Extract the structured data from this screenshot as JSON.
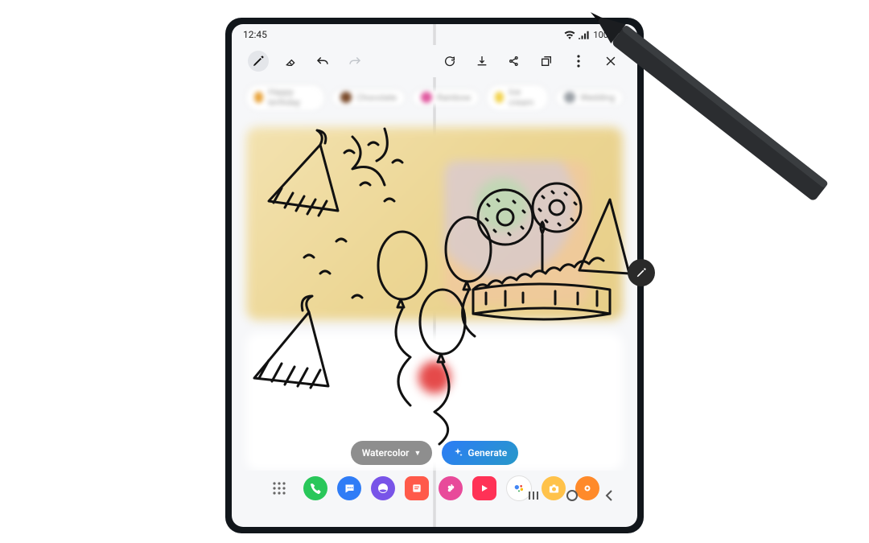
{
  "status_bar": {
    "time": "12:45",
    "battery": "100%",
    "wifi_icon": "wifi",
    "signal_icon": "signal-full"
  },
  "toolbar": {
    "left": [
      {
        "name": "pen-icon",
        "selected": true
      },
      {
        "name": "eraser-icon",
        "selected": false
      },
      {
        "name": "undo-icon",
        "selected": false
      },
      {
        "name": "redo-icon",
        "selected": false,
        "disabled": true
      }
    ],
    "right": [
      {
        "name": "refresh-icon"
      },
      {
        "name": "download-icon"
      },
      {
        "name": "share-icon"
      },
      {
        "name": "multiwindow-icon"
      },
      {
        "name": "more-icon"
      },
      {
        "name": "close-icon"
      }
    ]
  },
  "suggestion_chips": [
    {
      "label": "Happy birthday",
      "swatch": "#e8a23a"
    },
    {
      "label": "Chocolate",
      "swatch": "#7a4a2a"
    },
    {
      "label": "Rainbow",
      "swatch": "#e05aa0"
    },
    {
      "label": "Ice cream",
      "swatch": "#f2d24a"
    },
    {
      "label": "Wedding",
      "swatch": "#9aa0a6"
    }
  ],
  "style_picker": {
    "label": "Watercolor"
  },
  "generate_button": {
    "label": "Generate"
  },
  "floating_action": {
    "icon": "pen-icon"
  },
  "taskbar_apps": [
    {
      "name": "phone-app",
      "bg": "#29c75a",
      "glyph": "phone"
    },
    {
      "name": "messages-app",
      "bg": "#2f7cf6",
      "glyph": "message"
    },
    {
      "name": "browser-app",
      "bg": "#7854e8",
      "glyph": "globe"
    },
    {
      "name": "notes-app",
      "bg": "#ff5a4a",
      "glyph": "note"
    },
    {
      "name": "gallery-app",
      "bg": "#e84a9a",
      "glyph": "flower"
    },
    {
      "name": "video-app",
      "bg": "#ff3256",
      "glyph": "play"
    },
    {
      "name": "assistant-app",
      "bg": "#ffffff",
      "glyph": "assistant"
    },
    {
      "name": "camera-app",
      "bg": "#ffc24a",
      "glyph": "camera"
    },
    {
      "name": "tips-app",
      "bg": "#ff8a2a",
      "glyph": "bulb"
    }
  ],
  "nav_bar": {
    "recent": "recent-icon",
    "home": "home-icon",
    "back": "back-icon"
  },
  "drawing_subject": "birthday party sketch with hats, balloons, confetti, cake with donuts"
}
